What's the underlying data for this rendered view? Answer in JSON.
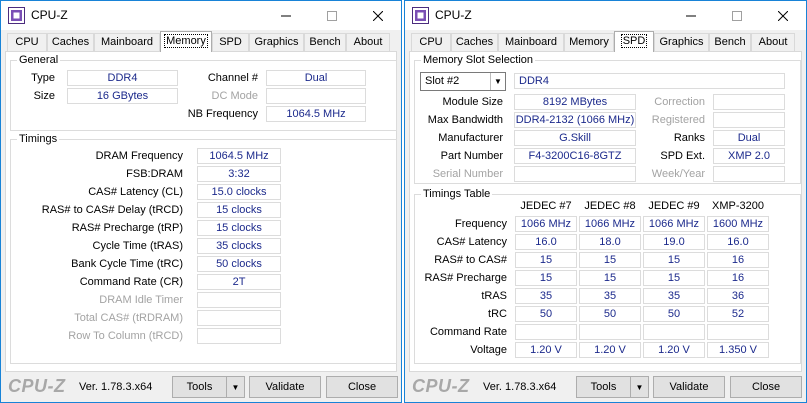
{
  "app_title": "CPU-Z",
  "tabs": [
    "CPU",
    "Caches",
    "Mainboard",
    "Memory",
    "SPD",
    "Graphics",
    "Bench",
    "About"
  ],
  "footer": {
    "brand": "CPU-Z",
    "version": "Ver. 1.78.3.x64",
    "tools_label": "Tools",
    "validate_label": "Validate",
    "close_label": "Close"
  },
  "memory": {
    "general": {
      "title": "General",
      "type_label": "Type",
      "type_value": "DDR4",
      "size_label": "Size",
      "size_value": "16 GBytes",
      "channel_label": "Channel #",
      "channel_value": "Dual",
      "dcmode_label": "DC Mode",
      "dcmode_value": "",
      "nbfreq_label": "NB Frequency",
      "nbfreq_value": "1064.5 MHz"
    },
    "timings": {
      "title": "Timings",
      "rows": [
        {
          "label": "DRAM Frequency",
          "value": "1064.5 MHz"
        },
        {
          "label": "FSB:DRAM",
          "value": "3:32"
        },
        {
          "label": "CAS# Latency (CL)",
          "value": "15.0 clocks"
        },
        {
          "label": "RAS# to CAS# Delay (tRCD)",
          "value": "15 clocks"
        },
        {
          "label": "RAS# Precharge (tRP)",
          "value": "15 clocks"
        },
        {
          "label": "Cycle Time (tRAS)",
          "value": "35 clocks"
        },
        {
          "label": "Bank Cycle Time (tRC)",
          "value": "50 clocks"
        },
        {
          "label": "Command Rate (CR)",
          "value": "2T"
        },
        {
          "label": "DRAM Idle Timer",
          "value": ""
        },
        {
          "label": "Total CAS# (tRDRAM)",
          "value": ""
        },
        {
          "label": "Row To Column (tRCD)",
          "value": ""
        }
      ]
    }
  },
  "spd": {
    "slot": {
      "title": "Memory Slot Selection",
      "selected": "Slot #2",
      "type": "DDR4",
      "module_size_label": "Module Size",
      "module_size": "8192 MBytes",
      "max_bw_label": "Max Bandwidth",
      "max_bw": "DDR4-2132 (1066 MHz)",
      "manufacturer_label": "Manufacturer",
      "manufacturer": "G.Skill",
      "part_label": "Part Number",
      "part": "F4-3200C16-8GTZ",
      "serial_label": "Serial Number",
      "serial": "",
      "correction_label": "Correction",
      "correction": "",
      "registered_label": "Registered",
      "registered": "",
      "ranks_label": "Ranks",
      "ranks": "Dual",
      "spdext_label": "SPD Ext.",
      "spdext": "XMP 2.0",
      "weekyear_label": "Week/Year",
      "weekyear": ""
    },
    "timings_table": {
      "title": "Timings Table",
      "columns": [
        "JEDEC #7",
        "JEDEC #8",
        "JEDEC #9",
        "XMP-3200"
      ],
      "rows": [
        {
          "label": "Frequency",
          "values": [
            "1066 MHz",
            "1066 MHz",
            "1066 MHz",
            "1600 MHz"
          ]
        },
        {
          "label": "CAS# Latency",
          "values": [
            "16.0",
            "18.0",
            "19.0",
            "16.0"
          ]
        },
        {
          "label": "RAS# to CAS#",
          "values": [
            "15",
            "15",
            "15",
            "16"
          ]
        },
        {
          "label": "RAS# Precharge",
          "values": [
            "15",
            "15",
            "15",
            "16"
          ]
        },
        {
          "label": "tRAS",
          "values": [
            "35",
            "35",
            "35",
            "36"
          ]
        },
        {
          "label": "tRC",
          "values": [
            "50",
            "50",
            "50",
            "52"
          ]
        },
        {
          "label": "Command Rate",
          "values": [
            "",
            "",
            "",
            ""
          ]
        },
        {
          "label": "Voltage",
          "values": [
            "1.20 V",
            "1.20 V",
            "1.20 V",
            "1.350 V"
          ]
        }
      ]
    }
  },
  "colors": {
    "value_text": "#1c2a8c",
    "window_border": "#1883d7",
    "dim_label": "#a3a3a3"
  }
}
